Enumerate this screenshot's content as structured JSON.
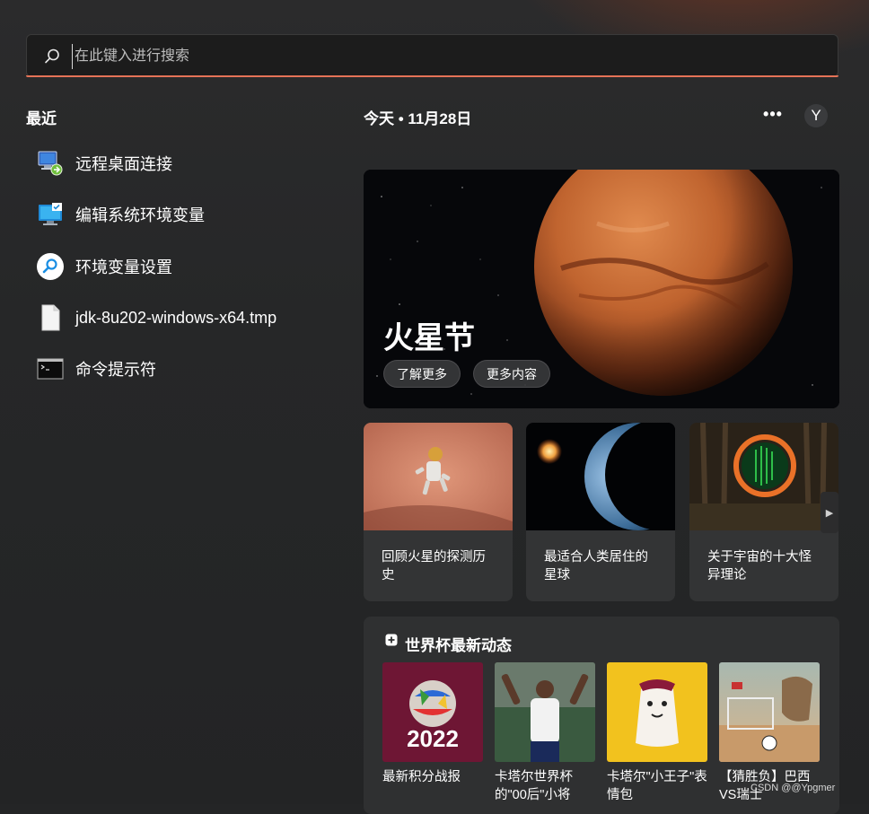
{
  "search": {
    "placeholder": "在此键入进行搜索"
  },
  "recent": {
    "title": "最近",
    "items": [
      {
        "label": "远程桌面连接",
        "icon": "remote-desktop-icon"
      },
      {
        "label": "编辑系统环境变量",
        "icon": "monitor-check-icon"
      },
      {
        "label": "环境变量设置",
        "icon": "search-circle-icon"
      },
      {
        "label": "jdk-8u202-windows-x64.tmp",
        "icon": "file-icon"
      },
      {
        "label": "命令提示符",
        "icon": "terminal-icon"
      }
    ]
  },
  "header": {
    "date": "今天 • 11月28日",
    "more": "•••",
    "avatar": "Y"
  },
  "hero": {
    "title": "火星节",
    "buttons": [
      "了解更多",
      "更多内容"
    ]
  },
  "cards": [
    {
      "caption": "回顾火星的探测历史"
    },
    {
      "caption": "最适合人类居住的星球"
    },
    {
      "caption": "关于宇宙的十大怪异理论"
    }
  ],
  "worldcup": {
    "title": "世界杯最新动态",
    "items": [
      {
        "caption": "最新积分战报",
        "badge": "2022"
      },
      {
        "caption": "卡塔尔世界杯的\"00后\"小将"
      },
      {
        "caption": "卡塔尔\"小王子\"表情包"
      },
      {
        "caption": "【猜胜负】巴西VS瑞士"
      }
    ]
  },
  "watermark": "CSDN @@Ypgmer",
  "colors": {
    "accent": "#e57357",
    "background": "#242526",
    "card": "#333435"
  }
}
